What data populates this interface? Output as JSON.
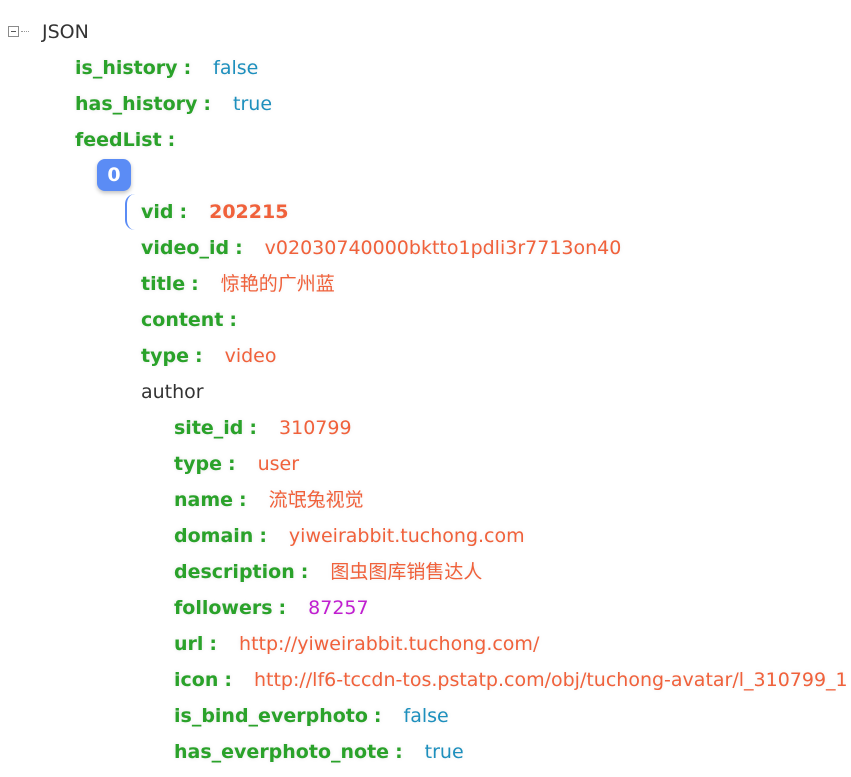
{
  "root": {
    "label": "JSON"
  },
  "top": {
    "is_history": {
      "key": "is_history",
      "value": "false"
    },
    "has_history": {
      "key": "has_history",
      "value": "true"
    },
    "feedList": {
      "key": "feedList"
    }
  },
  "item": {
    "index": "0",
    "vid": {
      "key": "vid",
      "value": "202215"
    },
    "video_id": {
      "key": "video_id",
      "value": "v02030740000bktto1pdli3r7713on40"
    },
    "title": {
      "key": "title",
      "value": "惊艳的广州蓝"
    },
    "content": {
      "key": "content"
    },
    "type": {
      "key": "type",
      "value": "video"
    },
    "author_label": "author"
  },
  "author": {
    "site_id": {
      "key": "site_id",
      "value": "310799"
    },
    "type": {
      "key": "type",
      "value": "user"
    },
    "name": {
      "key": "name",
      "value": "流氓兔视觉"
    },
    "domain": {
      "key": "domain",
      "value": "yiweirabbit.tuchong.com"
    },
    "description": {
      "key": "description",
      "value": "图虫图库销售达人"
    },
    "followers": {
      "key": "followers",
      "value": "87257"
    },
    "url": {
      "key": "url",
      "value": "http://yiweirabbit.tuchong.com/"
    },
    "icon": {
      "key": "icon",
      "value": "http://lf6-tccdn-tos.pstatp.com/obj/tuchong-avatar/l_310799_1"
    },
    "is_bind_everphoto": {
      "key": "is_bind_everphoto",
      "value": "false"
    },
    "has_everphoto_note": {
      "key": "has_everphoto_note",
      "value": "true"
    }
  },
  "colon": ":"
}
